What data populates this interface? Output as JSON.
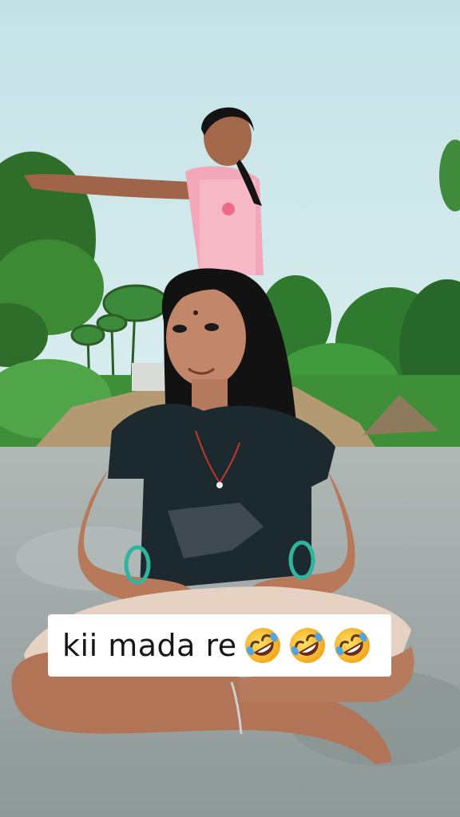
{
  "caption": {
    "text": "kii mada re",
    "emojis": [
      "rolling-on-floor-laughing-emoji",
      "rolling-on-floor-laughing-emoji",
      "rolling-on-floor-laughing-emoji"
    ]
  },
  "colors": {
    "sky": "#cfe6ea",
    "foliage": "#2f7a2e",
    "ground": "#9aa5a4",
    "caption_bg": "#ffffff",
    "caption_text": "#161616",
    "emoji_face": "#f7c531"
  }
}
